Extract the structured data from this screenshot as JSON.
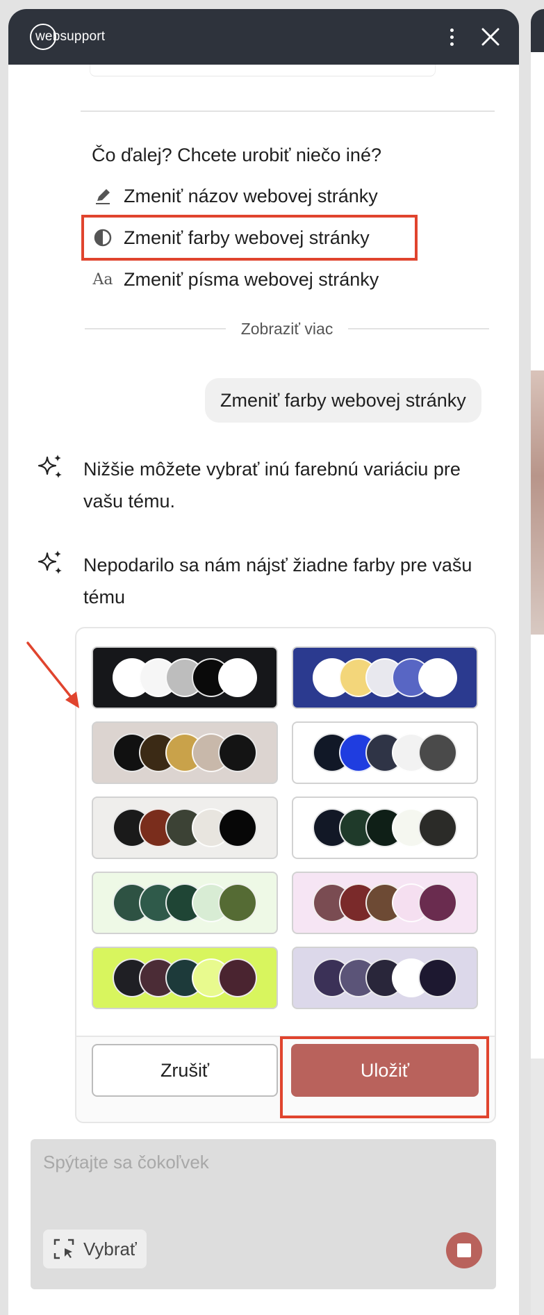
{
  "header": {
    "logo_text": "websupport"
  },
  "question": "Čo ďalej? Chcete urobiť niečo iné?",
  "options": [
    {
      "label": "Zmeniť názov webovej stránky",
      "icon": "pencil-icon"
    },
    {
      "label": "Zmeniť farby webovej stránky",
      "icon": "contrast-icon"
    },
    {
      "label": "Zmeniť písma webovej stránky",
      "icon": "font-icon",
      "icon_text": "Aa"
    }
  ],
  "show_more": "Zobraziť viac",
  "user_message": "Zmeniť farby webovej stránky",
  "bot_messages": [
    "Nižšie môžete vybrať inú farebnú variáciu pre vašu tému.",
    "Nepodarilo sa nám nájsť žiadne farby pre vašu tému"
  ],
  "palettes": [
    {
      "bg": "#16171a",
      "colors": [
        "#ffffff",
        "#f6f6f6",
        "#bdbdbd",
        "#0a0a0a",
        "#ffffff"
      ]
    },
    {
      "bg": "#2b3a8f",
      "colors": [
        "#ffffff",
        "#f3d67a",
        "#e8e8ee",
        "#5866c4",
        "#ffffff"
      ]
    },
    {
      "bg": "#dcd4d0",
      "colors": [
        "#111111",
        "#3b2a15",
        "#c9a24a",
        "#c8b8aa",
        "#141414"
      ]
    },
    {
      "bg": "#ffffff",
      "colors": [
        "#111827",
        "#1f3de0",
        "#2f3446",
        "#f2f2f2",
        "#4a4a4a"
      ]
    },
    {
      "bg": "#efeeec",
      "colors": [
        "#1a1a1a",
        "#7a2d1c",
        "#3c4235",
        "#e8e5df",
        "#070707"
      ]
    },
    {
      "bg": "#ffffff",
      "colors": [
        "#121826",
        "#1f3a2a",
        "#0f1f17",
        "#f5f7f0",
        "#2b2b28"
      ]
    },
    {
      "bg": "#eef9e6",
      "colors": [
        "#2e5243",
        "#2f5a4a",
        "#1f4535",
        "#d8ecd4",
        "#556b34"
      ]
    },
    {
      "bg": "#f6e5f4",
      "colors": [
        "#7a4c52",
        "#7a2a2a",
        "#6d4a34",
        "#f5dff0",
        "#6a2c4f"
      ]
    },
    {
      "bg": "#d8f55e",
      "colors": [
        "#1f1f24",
        "#4b2c36",
        "#1d3a3a",
        "#e8fa8e",
        "#4a2430"
      ]
    },
    {
      "bg": "#dcd8ea",
      "colors": [
        "#3b3157",
        "#5b5478",
        "#29263a",
        "#ffffff",
        "#1d1830"
      ]
    }
  ],
  "buttons": {
    "cancel": "Zrušiť",
    "save": "Uložiť"
  },
  "input": {
    "placeholder": "Spýtajte sa čokoľvek",
    "select_label": "Vybrať"
  },
  "colors": {
    "header_bg": "#2e333c",
    "accent": "#b9625c",
    "highlight": "#e0442e"
  }
}
